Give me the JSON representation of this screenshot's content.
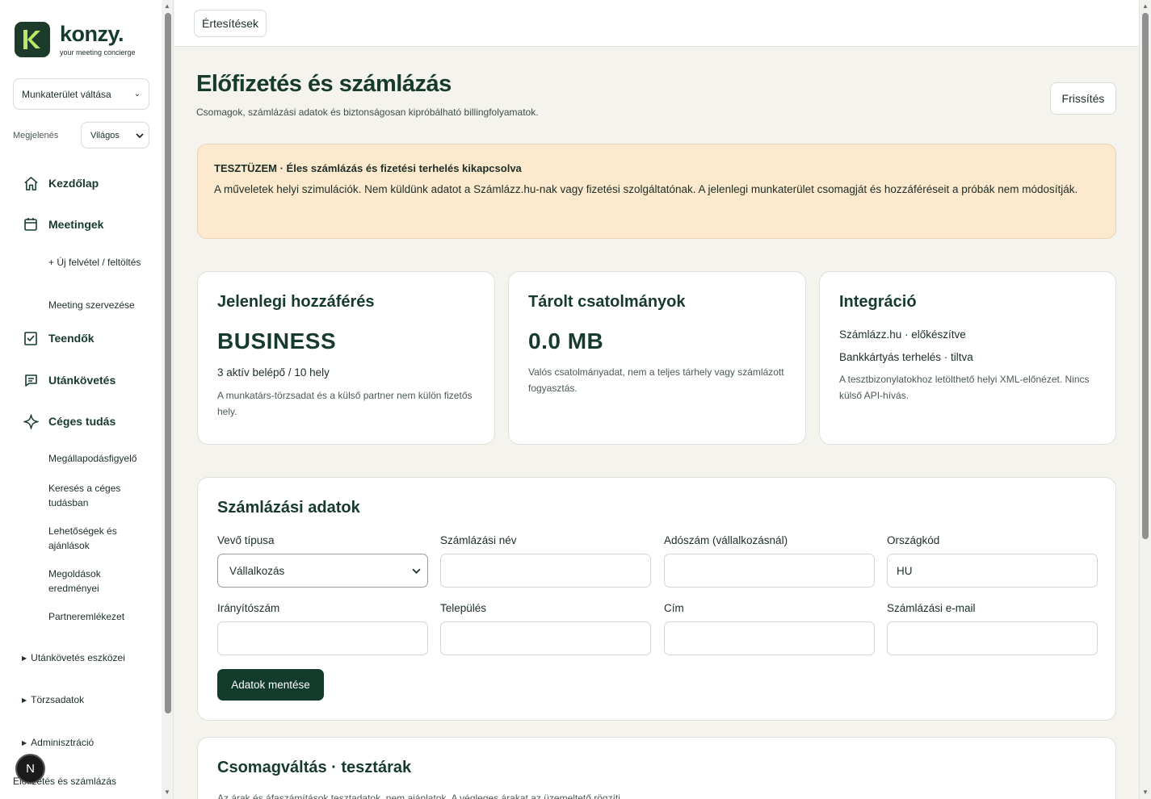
{
  "brand": {
    "name": "konzy.",
    "tagline": "your meeting concierge"
  },
  "sidebar": {
    "workspace_switch": "Munkaterület váltása",
    "appearance_label": "Megjelenés",
    "appearance_value": "Világos",
    "nav": {
      "home": "Kezdőlap",
      "meetings": "Meetingek",
      "new_recording": "+ Új felvétel / feltöltés",
      "organize_meeting": "Meeting szervezése",
      "todos": "Teendők",
      "followups": "Utánkövetés",
      "company_knowledge": "Céges tudás",
      "agreement_watch": "Megállapodásfigyelő",
      "knowledge_search": "Keresés a céges tudásban",
      "opportunities": "Lehetőségek és ajánlások",
      "solution_results": "Megoldások eredményei",
      "partner_memory": "Partneremlékezet",
      "followup_tools": "Utánkövetés eszközei",
      "master_data": "Törzsadatok",
      "administration": "Adminisztráció",
      "billing": "Előfizetés és számlázás"
    },
    "avatar_letter": "N"
  },
  "topbar": {
    "notifications": "Értesítések"
  },
  "page": {
    "title": "Előfizetés és számlázás",
    "subtitle": "Csomagok, számlázási adatok és biztonságosan kipróbálható billingfolyamatok.",
    "refresh": "Frissítés"
  },
  "alert": {
    "title": "TESZTÜZEM · Éles számlázás és fizetési terhelés kikapcsolva",
    "body": "A műveletek helyi szimulációk. Nem küldünk adatot a Számlázz.hu-nak vagy fizetési szolgáltatónak. A jelenlegi munkaterület csomagját és hozzáféréseit a próbák nem módosítják."
  },
  "cards": {
    "access": {
      "title": "Jelenlegi hozzáférés",
      "plan": "BUSINESS",
      "seats": "3 aktív belépő / 10 hely",
      "note": "A munkatárs-törzsadat és a külső partner nem külön fizetős hely."
    },
    "storage": {
      "title": "Tárolt csatolmányok",
      "value": "0.0 MB",
      "note": "Valós csatolmányadat, nem a teljes tárhely vagy számlázott fogyasztás."
    },
    "integration": {
      "title": "Integráció",
      "line1": "Számlázz.hu · előkészítve",
      "line2": "Bankkártyás terhelés · tiltva",
      "note": "A tesztbizonylatokhoz letölthető helyi XML-előnézet. Nincs külső API-hívás."
    }
  },
  "billing_form": {
    "title": "Számlázási adatok",
    "buyer_type_label": "Vevő típusa",
    "buyer_type_value": "Vállalkozás",
    "billing_name_label": "Számlázási név",
    "billing_name_value": "",
    "tax_number_label": "Adószám (vállalkozásnál)",
    "tax_number_value": "",
    "country_code_label": "Országkód",
    "country_code_value": "HU",
    "zip_label": "Irányítószám",
    "zip_value": "",
    "city_label": "Település",
    "city_value": "",
    "address_label": "Cím",
    "address_value": "",
    "email_label": "Számlázási e-mail",
    "email_value": "",
    "save": "Adatok mentése"
  },
  "package": {
    "title": "Csomagváltás · tesztárak",
    "subtitle": "Az árak és áfaszámítások tesztadatok, nem ajánlatok. A végleges árakat az üzemeltető rögzíti."
  },
  "colors": {
    "primary": "#133b2c",
    "alert_bg": "#fde9cd",
    "page_bg": "#f4f3ee"
  }
}
